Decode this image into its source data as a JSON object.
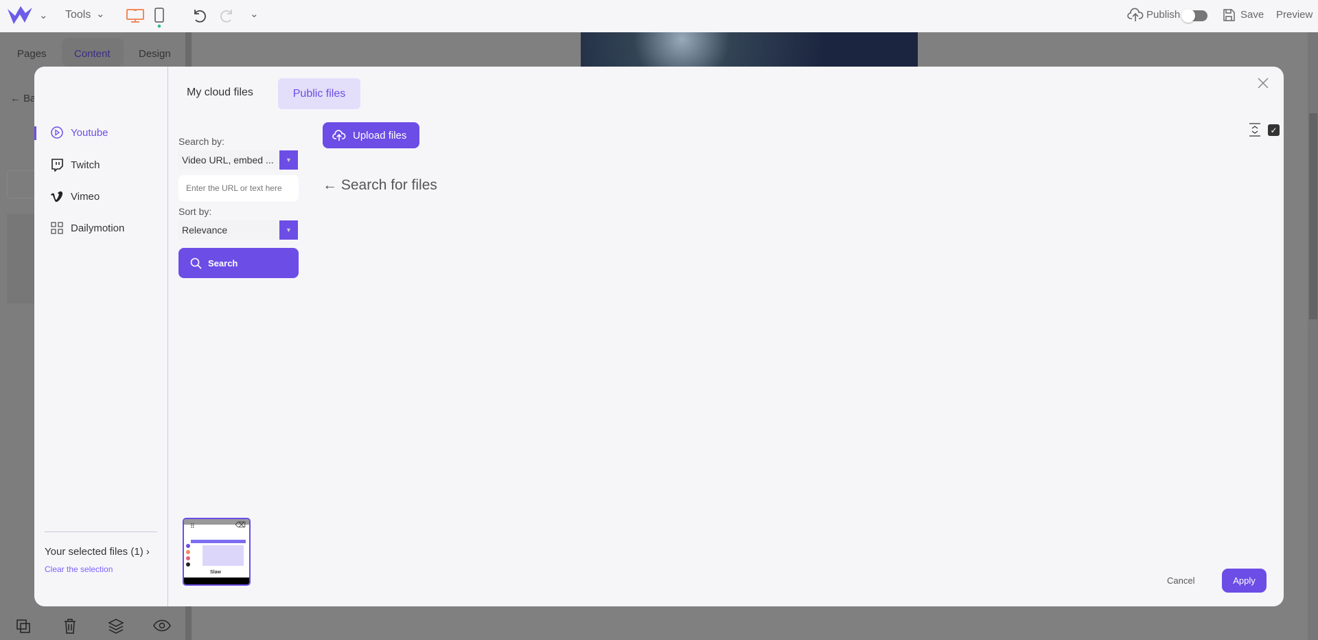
{
  "topbar": {
    "tools_label": "Tools",
    "publish_label": "Publish",
    "publish_enabled": false,
    "save_label": "Save",
    "preview_label": "Preview",
    "accent": "#6c4de6",
    "device_active_color": "#f08a5d"
  },
  "left_panel": {
    "tabs": [
      "Pages",
      "Content",
      "Design"
    ],
    "active_tab": "Content",
    "back_label": "Ba"
  },
  "modal": {
    "tabs": [
      {
        "label": "My cloud files"
      },
      {
        "label": "Public files",
        "active": true
      }
    ],
    "sources": [
      {
        "label": "Youtube",
        "icon": "play-circle-icon",
        "active": true
      },
      {
        "label": "Twitch",
        "icon": "twitch-icon"
      },
      {
        "label": "Vimeo",
        "icon": "vimeo-icon"
      },
      {
        "label": "Dailymotion",
        "icon": "grid-icon"
      }
    ],
    "search_by_label": "Search by:",
    "search_by_value": "Video URL, embed ...",
    "input_placeholder": "Enter the URL or text here",
    "sort_by_label": "Sort by:",
    "sort_by_value": "Relevance",
    "search_button": "Search",
    "upload_button": "Upload files",
    "empty_message": "← Search for files",
    "selected_files_label": "Your selected files (1) ›",
    "clear_selection": "Clear the selection",
    "cancel_label": "Cancel",
    "apply_label": "Apply",
    "thumbnail_text": "Slaw"
  }
}
